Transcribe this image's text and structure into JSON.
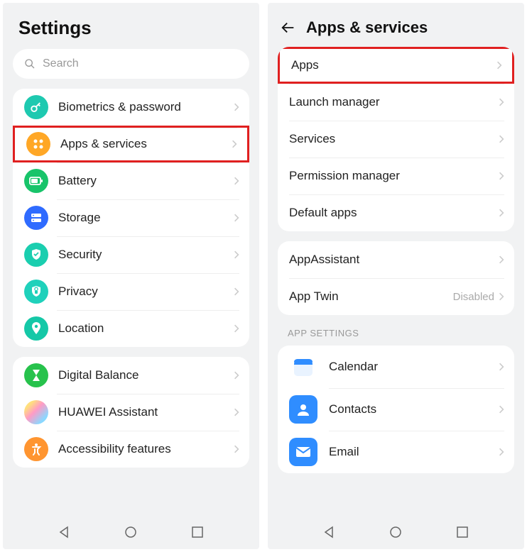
{
  "left": {
    "title": "Settings",
    "search_placeholder": "Search",
    "group1": [
      {
        "key": "biometrics",
        "label": "Biometrics & password"
      },
      {
        "key": "apps",
        "label": "Apps & services",
        "highlight": true
      },
      {
        "key": "battery",
        "label": "Battery"
      },
      {
        "key": "storage",
        "label": "Storage"
      },
      {
        "key": "security",
        "label": "Security"
      },
      {
        "key": "privacy",
        "label": "Privacy"
      },
      {
        "key": "location",
        "label": "Location"
      }
    ],
    "group2": [
      {
        "key": "digital",
        "label": "Digital Balance"
      },
      {
        "key": "assistant",
        "label": "HUAWEI Assistant"
      },
      {
        "key": "accessibility",
        "label": "Accessibility features"
      }
    ]
  },
  "right": {
    "title": "Apps & services",
    "group1": [
      {
        "key": "apps",
        "label": "Apps",
        "highlight": true
      },
      {
        "key": "launch",
        "label": "Launch manager"
      },
      {
        "key": "services",
        "label": "Services"
      },
      {
        "key": "perm",
        "label": "Permission manager"
      },
      {
        "key": "default",
        "label": "Default apps"
      }
    ],
    "group2": [
      {
        "key": "appassist",
        "label": "AppAssistant"
      },
      {
        "key": "apptwin",
        "label": "App Twin",
        "sub": "Disabled"
      }
    ],
    "section_title": "APP SETTINGS",
    "group3": [
      {
        "key": "calendar",
        "label": "Calendar"
      },
      {
        "key": "contacts",
        "label": "Contacts"
      },
      {
        "key": "email",
        "label": "Email"
      }
    ]
  }
}
